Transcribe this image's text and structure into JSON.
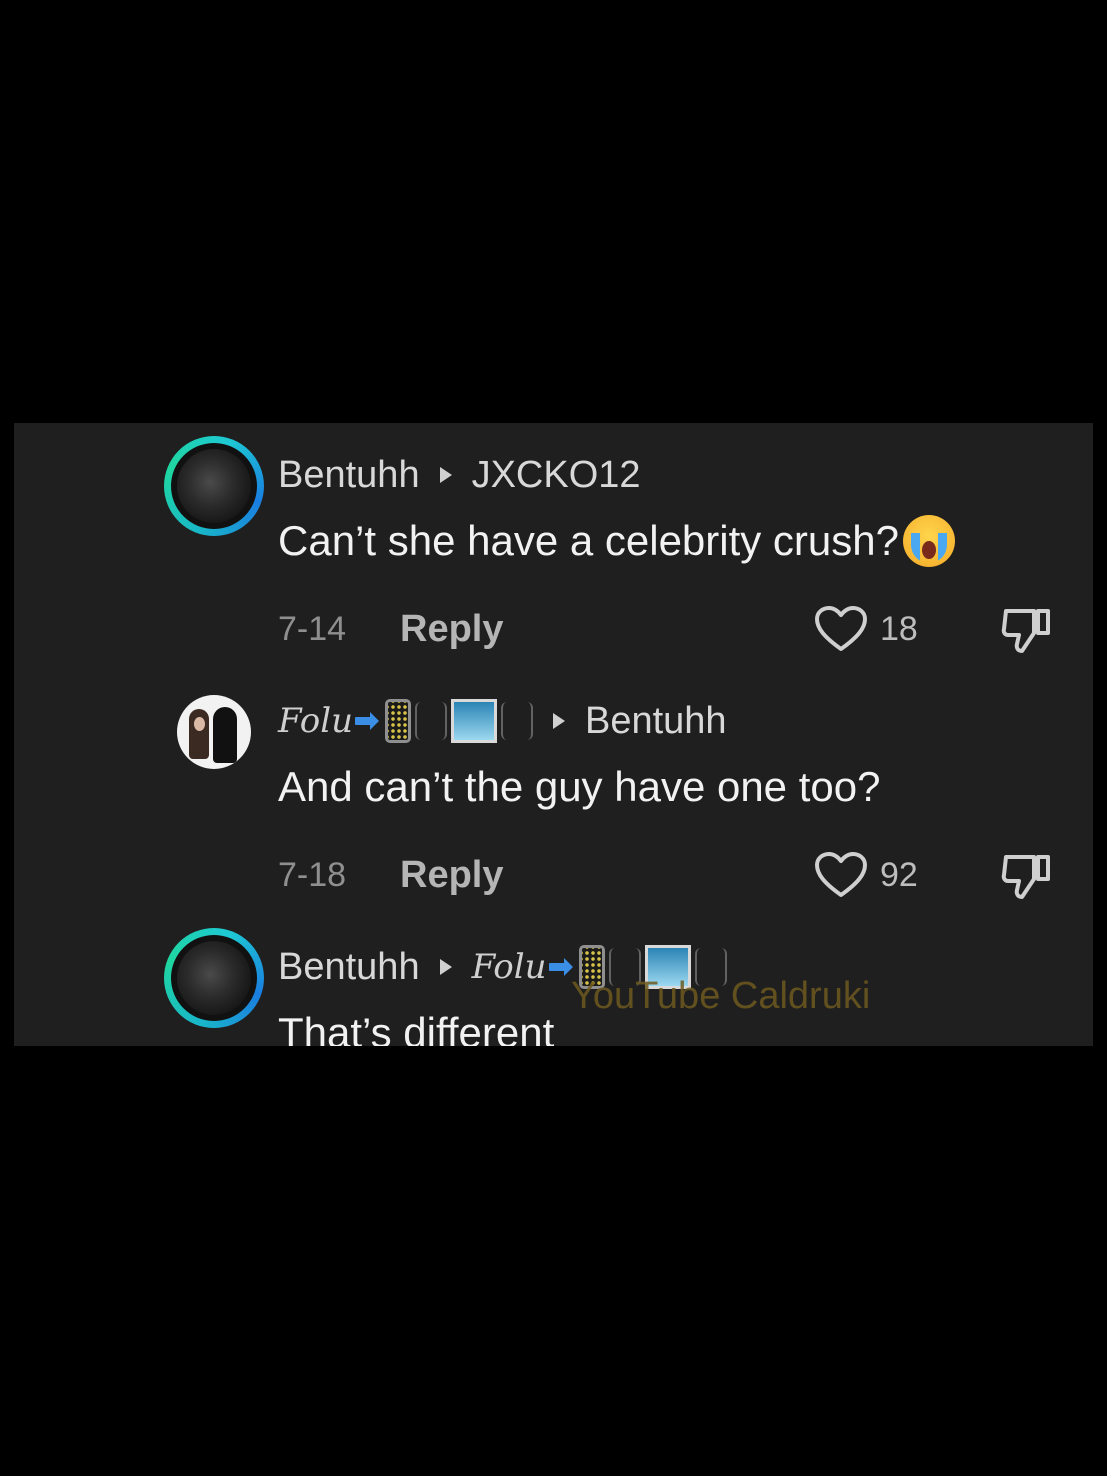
{
  "comments": [
    {
      "username": "Bentuhh",
      "reply_to": "JXCKO12",
      "text": "Can’t she have a celebrity crush?",
      "emoji": "loudly-crying-face",
      "date": "7-14",
      "reply_label": "Reply",
      "likes": "18"
    },
    {
      "username": "Folu",
      "reply_to": "Bentuhh",
      "text": "And can’t the guy have one too?",
      "date": "7-18",
      "reply_label": "Reply",
      "likes": "92"
    },
    {
      "username": "Bentuhh",
      "reply_to": "Folu",
      "text": "That’s different"
    }
  ],
  "watermark": "YouTube Caldruki",
  "colors": {
    "background": "#000000",
    "panel": "#1f1f1f",
    "ring": "#1ec8d4",
    "watermark": "#6e5a1e"
  }
}
